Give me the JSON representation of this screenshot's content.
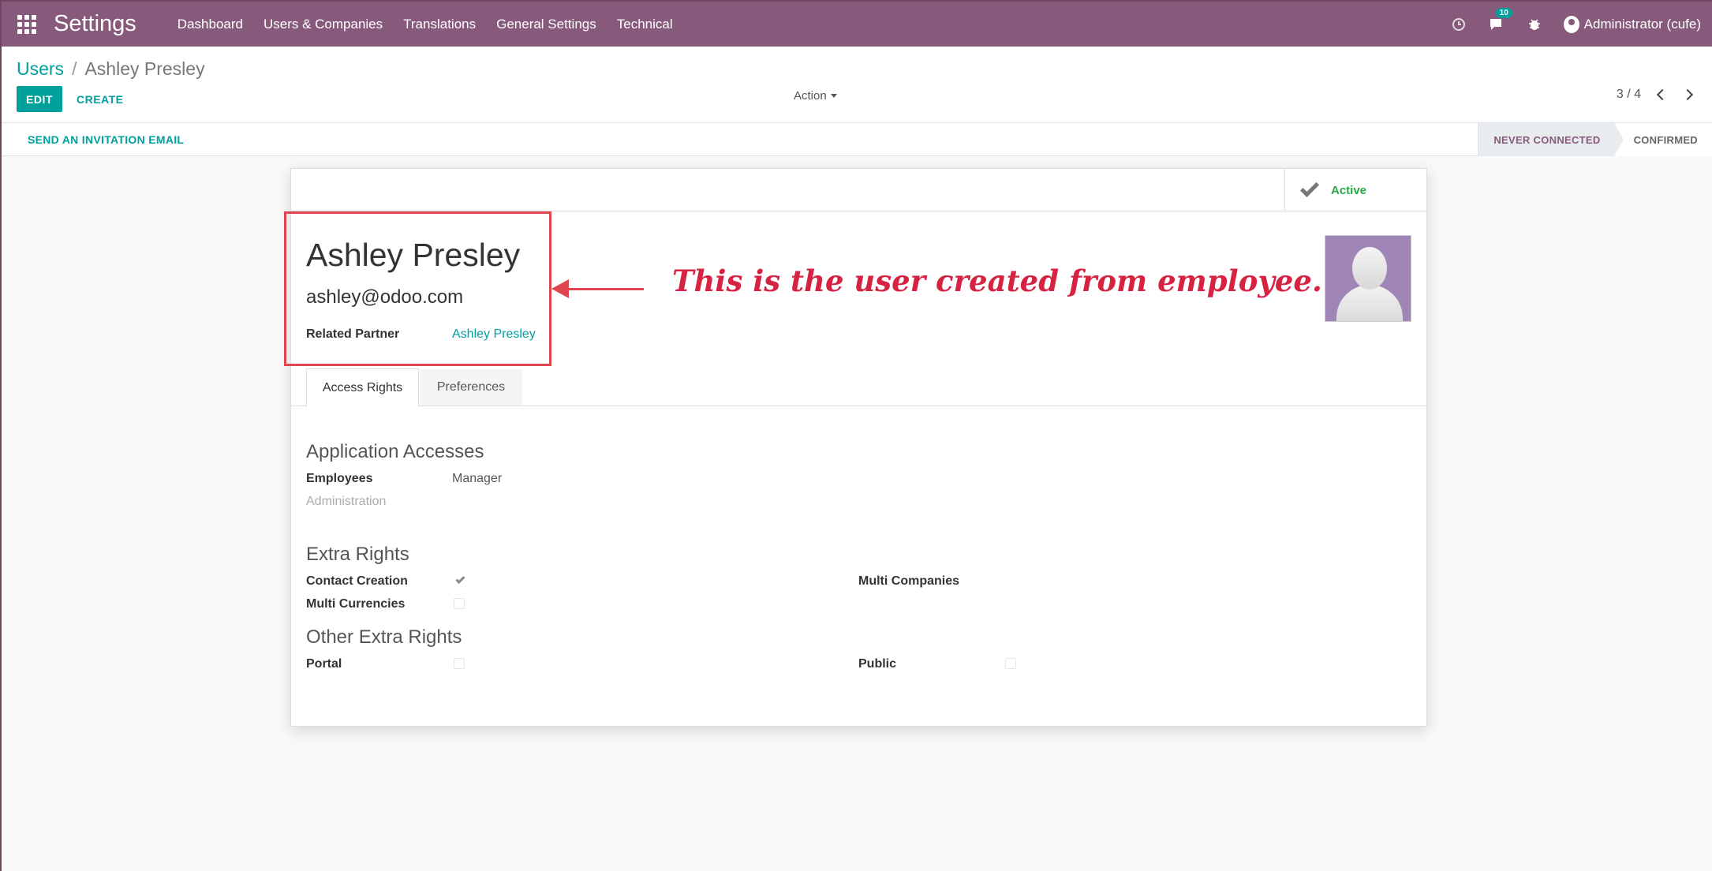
{
  "navbar": {
    "app_title": "Settings",
    "menu": [
      "Dashboard",
      "Users & Companies",
      "Translations",
      "General Settings",
      "Technical"
    ],
    "message_count": "10",
    "user_label": "Administrator (cufe)",
    "bg_color": "#875a7b"
  },
  "breadcrumb": {
    "parent": "Users",
    "separator": "/",
    "current": "Ashley Presley"
  },
  "buttons": {
    "edit": "EDIT",
    "create": "CREATE",
    "action": "Action",
    "invite": "SEND AN INVITATION EMAIL"
  },
  "pager": {
    "value": "3 / 4"
  },
  "stages": {
    "active": "NEVER CONNECTED",
    "next": "CONFIRMED"
  },
  "form": {
    "active_label": "Active",
    "name": "Ashley Presley",
    "email": "ashley@odoo.com",
    "related_partner_label": "Related Partner",
    "related_partner_value": "Ashley Presley"
  },
  "annotation": "This is the user created from employee.",
  "tabs": [
    "Access Rights",
    "Preferences"
  ],
  "access": {
    "app_title": "Application Accesses",
    "employees_label": "Employees",
    "employees_value": "Manager",
    "administration_label": "Administration",
    "extra_title": "Extra Rights",
    "contact_creation": "Contact Creation",
    "multi_companies": "Multi Companies",
    "multi_currencies": "Multi Currencies",
    "other_title": "Other Extra Rights",
    "portal": "Portal",
    "public": "Public"
  },
  "colors": {
    "accent": "#00a09d",
    "annotation": "#d62342",
    "highlight": "#e04550"
  }
}
